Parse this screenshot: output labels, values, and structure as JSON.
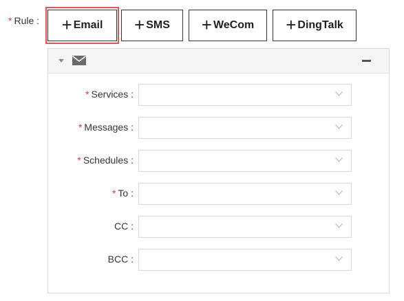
{
  "rule": {
    "required_mark": "*",
    "label": "Rule :"
  },
  "buttons": [
    {
      "icon": "plus-icon",
      "label": "Email",
      "highlighted": true
    },
    {
      "icon": "plus-icon",
      "label": "SMS"
    },
    {
      "icon": "plus-icon",
      "label": "WeCom"
    },
    {
      "icon": "plus-icon",
      "label": "DingTalk"
    }
  ],
  "panel": {
    "header_icons": [
      "caret-down-icon",
      "mail-icon",
      "collapse-icon"
    ],
    "fields": [
      {
        "required_mark": "*",
        "label": "Services :",
        "value": ""
      },
      {
        "required_mark": "*",
        "label": "Messages :",
        "value": ""
      },
      {
        "required_mark": "*",
        "label": "Schedules :",
        "value": ""
      },
      {
        "required_mark": "*",
        "label": "To :",
        "value": ""
      },
      {
        "required_mark": "",
        "label": "CC :",
        "value": ""
      },
      {
        "required_mark": "",
        "label": "BCC :",
        "value": ""
      }
    ]
  },
  "colors": {
    "required": "#d9363e",
    "highlight": "#e8534a",
    "border": "#d9d9d9",
    "header_bg": "#f5f5f5"
  }
}
